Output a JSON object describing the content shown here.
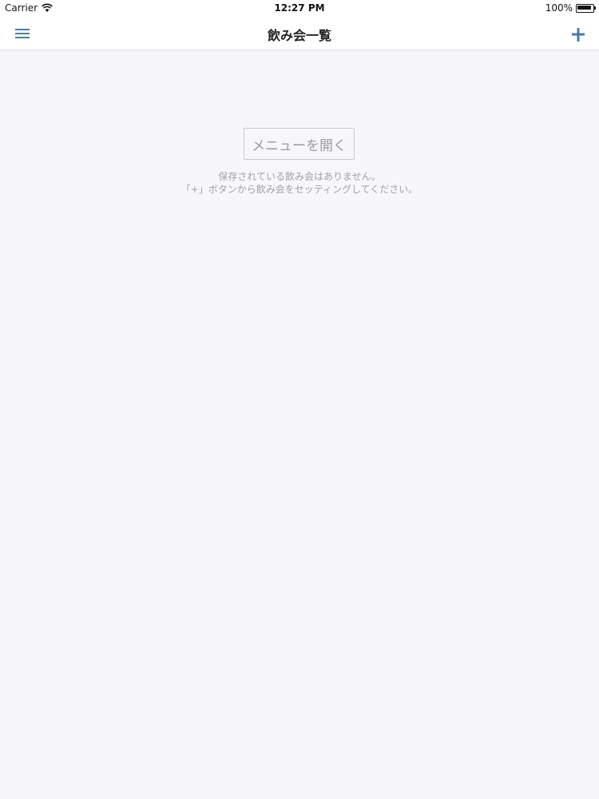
{
  "status_bar": {
    "carrier": "Carrier",
    "time": "12:27 PM",
    "battery": "100%"
  },
  "nav": {
    "title": "飲み会一覧",
    "menu_icon": "hamburger-menu-icon",
    "add_icon": "plus-icon",
    "accent_color": "#4a7ab5"
  },
  "main": {
    "open_menu_label": "メニューを開く",
    "empty_line1": "保存されている飲み会はありません。",
    "empty_line2": "「+」ボタンから飲み会をセッティングしてください。"
  }
}
